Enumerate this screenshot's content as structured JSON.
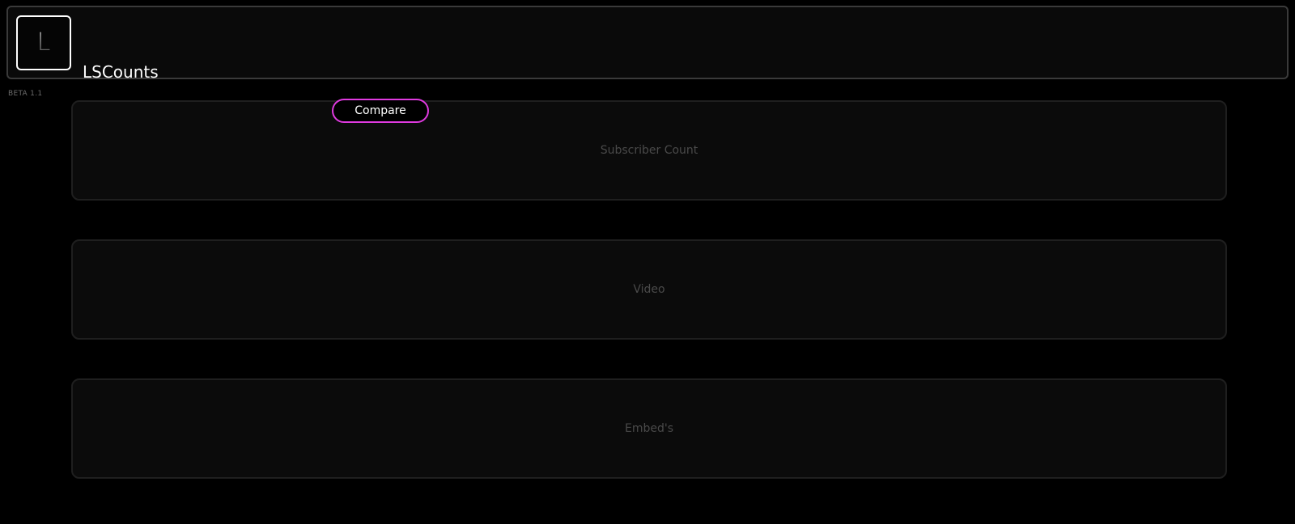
{
  "header": {
    "logo_letter": "L",
    "brand_name": "LSCounts",
    "version": "BETA 1.1"
  },
  "nav": {
    "compare_label": "Compare"
  },
  "sections": [
    {
      "label": "Subscriber Count"
    },
    {
      "label": "Video"
    },
    {
      "label": "Embed's"
    }
  ],
  "colors": {
    "background": "#000000",
    "accent": "#e03ae0",
    "panel": "#0b0b0b",
    "muted_text": "#4a4a4a"
  }
}
